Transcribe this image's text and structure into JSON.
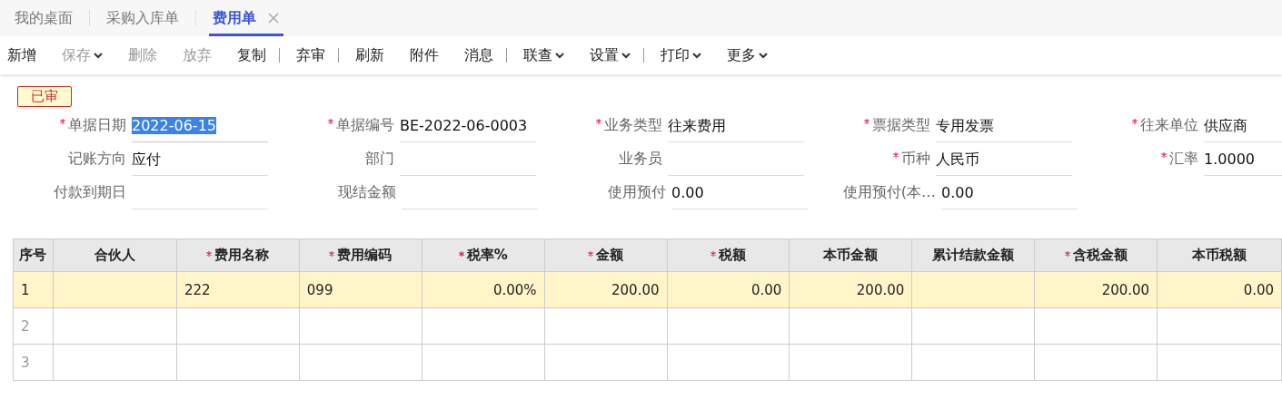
{
  "tabs": [
    {
      "label": "我的桌面",
      "selected": false,
      "closable": false
    },
    {
      "label": "采购入库单",
      "selected": false,
      "closable": false
    },
    {
      "label": "费用单",
      "selected": true,
      "closable": true
    }
  ],
  "toolbar": [
    {
      "label": "新增",
      "disabled": false,
      "dropdown": false,
      "divider_after": false
    },
    {
      "label": "保存",
      "disabled": true,
      "dropdown": true,
      "divider_after": false
    },
    {
      "label": "删除",
      "disabled": true,
      "dropdown": false,
      "divider_after": false
    },
    {
      "label": "放弃",
      "disabled": true,
      "dropdown": false,
      "divider_after": false
    },
    {
      "label": "复制",
      "disabled": false,
      "dropdown": false,
      "divider_after": true
    },
    {
      "label": "弃审",
      "disabled": false,
      "dropdown": false,
      "divider_after": true
    },
    {
      "label": "刷新",
      "disabled": false,
      "dropdown": false,
      "divider_after": false
    },
    {
      "label": "附件",
      "disabled": false,
      "dropdown": false,
      "divider_after": false
    },
    {
      "label": "消息",
      "disabled": false,
      "dropdown": false,
      "divider_after": true
    },
    {
      "label": "联查",
      "disabled": false,
      "dropdown": true,
      "divider_after": false
    },
    {
      "label": "设置",
      "disabled": false,
      "dropdown": true,
      "divider_after": true
    },
    {
      "label": "打印",
      "disabled": false,
      "dropdown": true,
      "divider_after": false
    },
    {
      "label": "更多",
      "disabled": false,
      "dropdown": true,
      "divider_after": false
    }
  ],
  "status_badge": "已审",
  "form_rows": [
    [
      {
        "label": "单据日期",
        "required": true,
        "value": "2022-06-15",
        "highlighted": true
      },
      {
        "label": "单据编号",
        "required": true,
        "value": "BE-2022-06-0003",
        "highlighted": false
      },
      {
        "label": "业务类型",
        "required": true,
        "value": "往来费用",
        "highlighted": false
      },
      {
        "label": "票据类型",
        "required": true,
        "value": "专用发票",
        "highlighted": false
      },
      {
        "label": "往来单位",
        "required": true,
        "value": "供应商",
        "highlighted": false
      }
    ],
    [
      {
        "label": "记账方向",
        "required": false,
        "value": "应付",
        "highlighted": false
      },
      {
        "label": "部门",
        "required": false,
        "highlighted": false
      },
      {
        "label": "业务员",
        "required": false,
        "highlighted": false
      },
      {
        "label": "币种",
        "required": true,
        "value": "人民币",
        "highlighted": false
      },
      {
        "label": "汇率",
        "required": true,
        "value": "1.0000",
        "highlighted": false
      }
    ],
    [
      {
        "label": "付款到期日",
        "required": false,
        "highlighted": false
      },
      {
        "label": "现结金额",
        "required": false,
        "highlighted": false
      },
      {
        "label": "使用预付",
        "required": false,
        "value": "0.00",
        "highlighted": false
      },
      {
        "label": "使用预付(本…",
        "required": false,
        "value": "0.00",
        "highlighted": false
      }
    ]
  ],
  "table": {
    "columns": [
      {
        "label": "序号",
        "required": false
      },
      {
        "label": "合伙人",
        "required": false
      },
      {
        "label": "费用名称",
        "required": true
      },
      {
        "label": "费用编码",
        "required": true
      },
      {
        "label": "税率%",
        "required": true
      },
      {
        "label": "金额",
        "required": true
      },
      {
        "label": "税额",
        "required": true
      },
      {
        "label": "本币金额",
        "required": false
      },
      {
        "label": "累计结款金额",
        "required": false
      },
      {
        "label": "含税金额",
        "required": true
      },
      {
        "label": "本币税额",
        "required": false
      }
    ],
    "rows": [
      {
        "selected": true,
        "cells": [
          "1",
          null,
          "222",
          "099",
          "0.00%",
          "200.00",
          "0.00",
          "200.00",
          null,
          "200.00",
          "0.00"
        ]
      },
      {
        "selected": false,
        "cells": [
          "2",
          null,
          null,
          null,
          null,
          null,
          null,
          null,
          null,
          null,
          null
        ]
      },
      {
        "selected": false,
        "cells": [
          "3",
          null,
          null,
          null,
          null,
          null,
          null,
          null,
          null,
          null,
          null
        ]
      }
    ]
  }
}
